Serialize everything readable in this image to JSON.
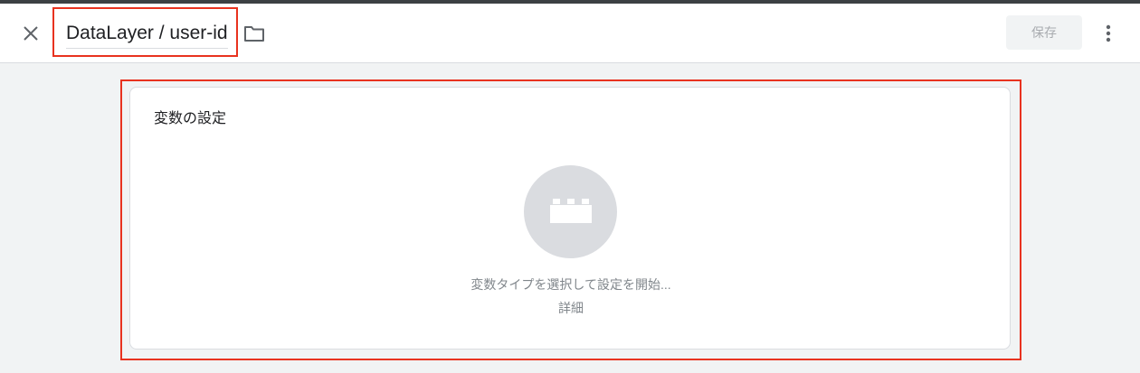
{
  "header": {
    "title": "DataLayer / user-id",
    "save_label": "保存",
    "icons": {
      "close": "close-icon",
      "folder": "folder-icon",
      "more": "more-vert-icon"
    }
  },
  "card": {
    "title": "変数の設定",
    "prompt": "変数タイプを選択して設定を開始...",
    "details_link": "詳細",
    "icon": "building-block-icon"
  },
  "colors": {
    "highlight": "#e8321f",
    "icon_circle": "#dadce0",
    "muted_text": "#80868b"
  }
}
